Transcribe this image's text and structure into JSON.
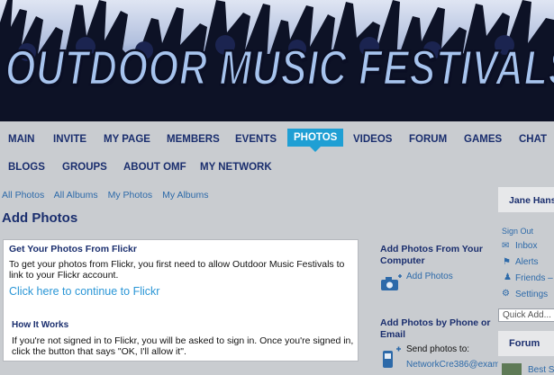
{
  "banner": {
    "title": "OUTDOOR MUSIC FESTIVALS"
  },
  "nav": {
    "row1": [
      "MAIN",
      "INVITE",
      "MY PAGE",
      "MEMBERS",
      "EVENTS",
      "PHOTOS",
      "VIDEOS",
      "FORUM",
      "GAMES",
      "CHAT"
    ],
    "row2": [
      "BLOGS",
      "GROUPS",
      "ABOUT OMF",
      "MY NETWORK"
    ],
    "active": "PHOTOS"
  },
  "subnav": [
    "All Photos",
    "All Albums",
    "My Photos",
    "My Albums"
  ],
  "page_title": "Add Photos",
  "flickr": {
    "heading": "Get Your Photos From Flickr",
    "description": "To get your photos from Flickr, you first need to allow Outdoor Music Festivals to link to your Flickr account.",
    "continue_link": "Click here to continue to Flickr",
    "how_heading": "How It Works",
    "how_text": "If you're not signed in to Flickr, you will be asked to sign in. Once you're signed in, click the button that says \"OK, I'll allow it\"."
  },
  "side": {
    "computer_heading": "Add Photos From Your Computer",
    "computer_link": "Add Photos",
    "phone_heading": "Add Photos by Phone or Email",
    "phone_text": "Send photos to:",
    "phone_email": "NetworkCre386@exam..."
  },
  "user": {
    "name": "Jane Hans",
    "sign_out": "Sign Out",
    "inbox": "Inbox",
    "alerts": "Alerts",
    "friends": "Friends –",
    "settings": "Settings",
    "quick_add": "Quick Add...",
    "forum": "Forum",
    "forum_item": "Best S"
  },
  "colors": {
    "accent": "#1f9fd4",
    "nav_text": "#1a2e6e",
    "link": "#2d6aa9",
    "page_bg": "#c9ccd0"
  }
}
